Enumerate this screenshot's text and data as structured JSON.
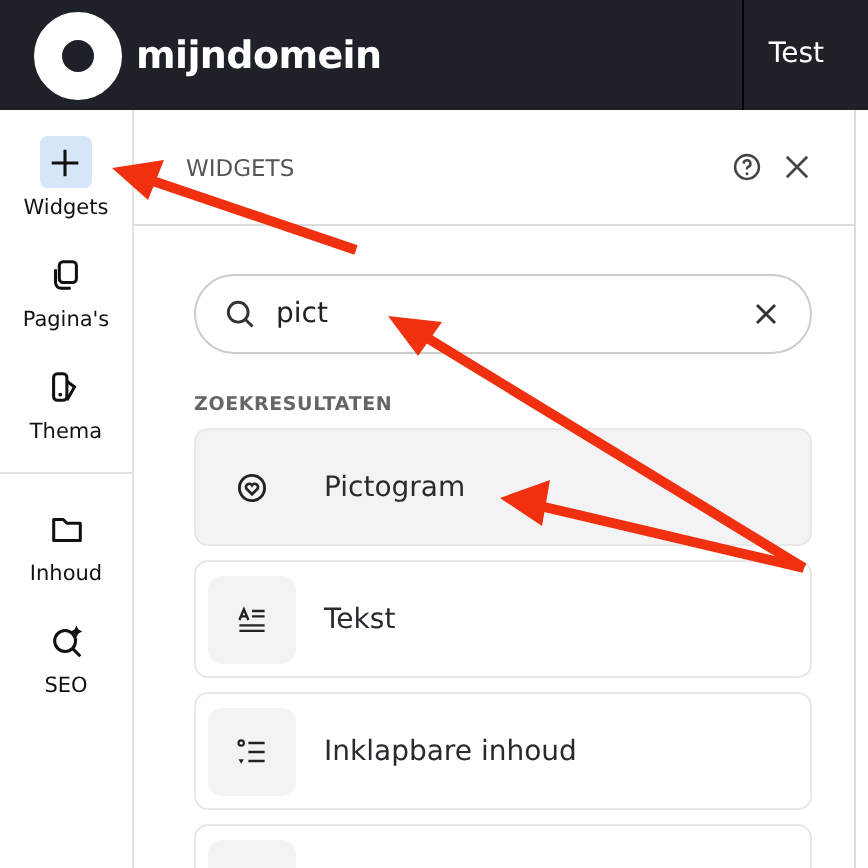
{
  "header": {
    "brand": "mijndomein",
    "site": "Test"
  },
  "sidebar": {
    "items": [
      {
        "label": "Widgets",
        "selected": true
      },
      {
        "label": "Pagina's",
        "selected": false
      },
      {
        "label": "Thema",
        "selected": false
      },
      {
        "label": "Inhoud",
        "selected": false,
        "divider_before": true
      },
      {
        "label": "SEO",
        "selected": false
      }
    ]
  },
  "panel": {
    "title": "WIDGETS",
    "search": {
      "value": "pict"
    },
    "section": "ZOEKRESULTATEN",
    "results": [
      {
        "label": "Pictogram",
        "selected": true
      },
      {
        "label": "Tekst",
        "selected": false
      },
      {
        "label": "Inklapbare inhoud",
        "selected": false
      },
      {
        "selected": false
      }
    ]
  }
}
